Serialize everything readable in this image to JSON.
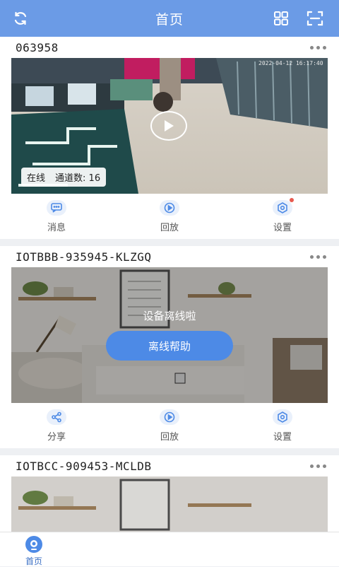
{
  "header": {
    "title": "首页",
    "left_icon": "refresh-icon",
    "right_icons": [
      "grid-view-icon",
      "scan-icon"
    ]
  },
  "devices": [
    {
      "name": "063958",
      "timestamp": "2022-04-12 16:17:40",
      "status": "在线",
      "channels_label": "通道数:",
      "channels_value": "16",
      "actions": [
        {
          "label": "消息",
          "icon": "message-icon"
        },
        {
          "label": "回放",
          "icon": "playback-icon"
        },
        {
          "label": "设置",
          "icon": "settings-icon",
          "has_dot": true
        }
      ]
    },
    {
      "name": "IOTBBB-935945-KLZGQ",
      "offline_text": "设备离线啦",
      "help_button": "离线帮助",
      "actions": [
        {
          "label": "分享",
          "icon": "share-icon"
        },
        {
          "label": "回放",
          "icon": "playback-icon"
        },
        {
          "label": "设置",
          "icon": "settings-icon"
        }
      ]
    },
    {
      "name": "IOTBCC-909453-MCLDB"
    }
  ],
  "tabbar": {
    "home_label": "首页"
  },
  "colors": {
    "accent": "#6b9be6",
    "button": "#4d8ae6",
    "dot": "#e85a4f"
  }
}
